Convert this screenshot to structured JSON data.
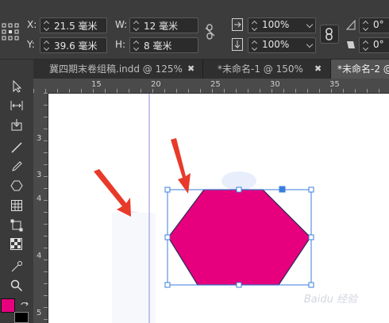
{
  "control_bar": {
    "x_label": "X:",
    "y_label": "Y:",
    "w_label": "W:",
    "h_label": "H:",
    "x_value": "21.5 毫米",
    "y_value": "39.6 毫米",
    "w_value": "12 毫米",
    "h_value": "8 毫米",
    "scale_x": "100%",
    "scale_y": "100%",
    "angle_1": "0°",
    "angle_2": "0°"
  },
  "tabs": [
    {
      "label": "冀四期末卷组稿.indd @ 125%",
      "close": "✖"
    },
    {
      "label": "*未命名-1 @ 150%",
      "close": "✖"
    },
    {
      "label": "*未命名-2 @",
      "close": ""
    }
  ],
  "ruler": {
    "h_ticks": [
      "15",
      "20",
      "25",
      "30",
      "35"
    ],
    "v_ticks": [
      "3",
      "3",
      "4",
      "4",
      "5"
    ]
  },
  "canvas": {
    "shape_fill": "#e6007e",
    "selection_color": "#3b7ddd",
    "arrow_color": "#e83a2a"
  },
  "watermark": "Baidu 经验"
}
